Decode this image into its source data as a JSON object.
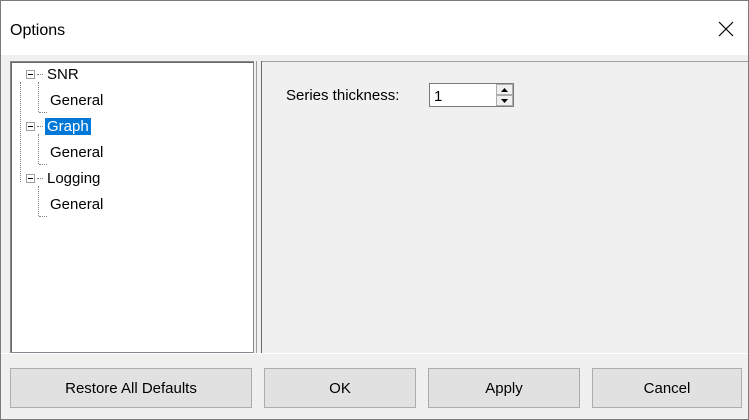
{
  "window": {
    "title": "Options",
    "close_icon": "close-icon"
  },
  "tree": {
    "nodes": [
      {
        "label": "SNR",
        "level": 0,
        "expanded": true,
        "selected": false
      },
      {
        "label": "General",
        "level": 1,
        "selected": false
      },
      {
        "label": "Graph",
        "level": 0,
        "expanded": true,
        "selected": true
      },
      {
        "label": "General",
        "level": 1,
        "selected": false
      },
      {
        "label": "Logging",
        "level": 0,
        "expanded": true,
        "selected": false
      },
      {
        "label": "General",
        "level": 1,
        "selected": false
      }
    ]
  },
  "settings": {
    "series_thickness_label": "Series thickness:",
    "series_thickness_value": "1"
  },
  "buttons": {
    "restore": "Restore All Defaults",
    "ok": "OK",
    "apply": "Apply",
    "cancel": "Cancel"
  },
  "colors": {
    "selection": "#0078d7",
    "panel_bg": "#f0f0f0",
    "button_bg": "#e1e1e1"
  }
}
